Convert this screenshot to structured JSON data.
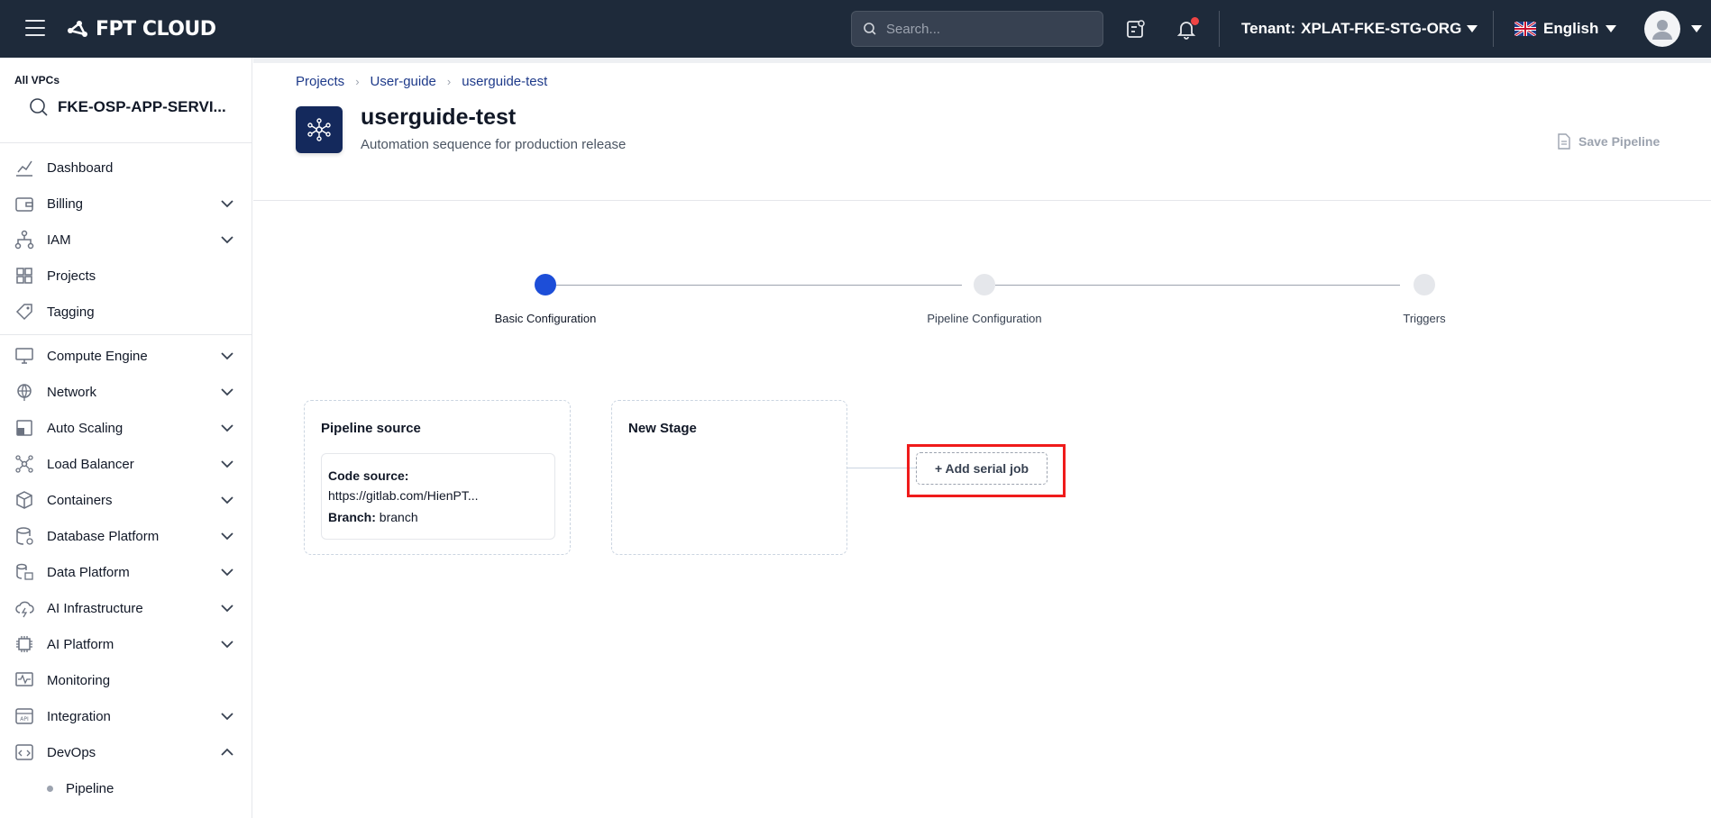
{
  "header": {
    "logo_text": "FPT CLOUD",
    "search_placeholder": "Search...",
    "tenant_label": "Tenant:",
    "tenant_value": "XPLAT-FKE-STG-ORG",
    "language": "English",
    "colors": {
      "bg": "#1e2a3a",
      "notification_dot": "#ef4444"
    }
  },
  "sidebar": {
    "vpc_label": "All VPCs",
    "vpc_name": "FKE-OSP-APP-SERVI...",
    "items": [
      {
        "label": "Dashboard",
        "icon": "chart-icon",
        "expandable": false
      },
      {
        "label": "Billing",
        "icon": "wallet-icon",
        "expandable": true
      },
      {
        "label": "IAM",
        "icon": "hierarchy-icon",
        "expandable": true
      },
      {
        "label": "Projects",
        "icon": "projects-icon",
        "expandable": false
      },
      {
        "label": "Tagging",
        "icon": "tag-icon",
        "expandable": false
      },
      {
        "label": "Compute Engine",
        "icon": "monitor-icon",
        "expandable": true
      },
      {
        "label": "Network",
        "icon": "globe-icon",
        "expandable": true
      },
      {
        "label": "Auto Scaling",
        "icon": "autoscale-icon",
        "expandable": true
      },
      {
        "label": "Load Balancer",
        "icon": "load-balancer-icon",
        "expandable": true
      },
      {
        "label": "Containers",
        "icon": "box-icon",
        "expandable": true
      },
      {
        "label": "Database Platform",
        "icon": "database-icon",
        "expandable": true
      },
      {
        "label": "Data Platform",
        "icon": "data-platform-icon",
        "expandable": true
      },
      {
        "label": "AI Infrastructure",
        "icon": "cloud-ai-icon",
        "expandable": true
      },
      {
        "label": "AI Platform",
        "icon": "chip-icon",
        "expandable": true
      },
      {
        "label": "Monitoring",
        "icon": "pulse-icon",
        "expandable": false
      },
      {
        "label": "Integration",
        "icon": "api-icon",
        "expandable": true
      },
      {
        "label": "DevOps",
        "icon": "code-icon",
        "expandable": true,
        "expanded": true
      }
    ],
    "sub_items": [
      {
        "label": "Pipeline"
      }
    ]
  },
  "breadcrumb": [
    "Projects",
    "User-guide",
    "userguide-test"
  ],
  "project": {
    "title": "userguide-test",
    "subtitle": "Automation sequence for production release",
    "save_label": "Save Pipeline"
  },
  "steps": [
    {
      "label": "Basic Configuration",
      "active": true
    },
    {
      "label": "Pipeline Configuration",
      "active": false
    },
    {
      "label": "Triggers",
      "active": false
    }
  ],
  "pipeline_source": {
    "title": "Pipeline source",
    "code_source_label": "Code source:",
    "code_source_value": "https://gitlab.com/HienPT...",
    "branch_label": "Branch:",
    "branch_value": "branch"
  },
  "new_stage": {
    "title": "New Stage",
    "add_job_label": "+ Add serial job"
  },
  "accent_colors": {
    "active_step": "#1d4ed8",
    "highlight": "#ef1b1b",
    "link": "#1e3a8a"
  }
}
